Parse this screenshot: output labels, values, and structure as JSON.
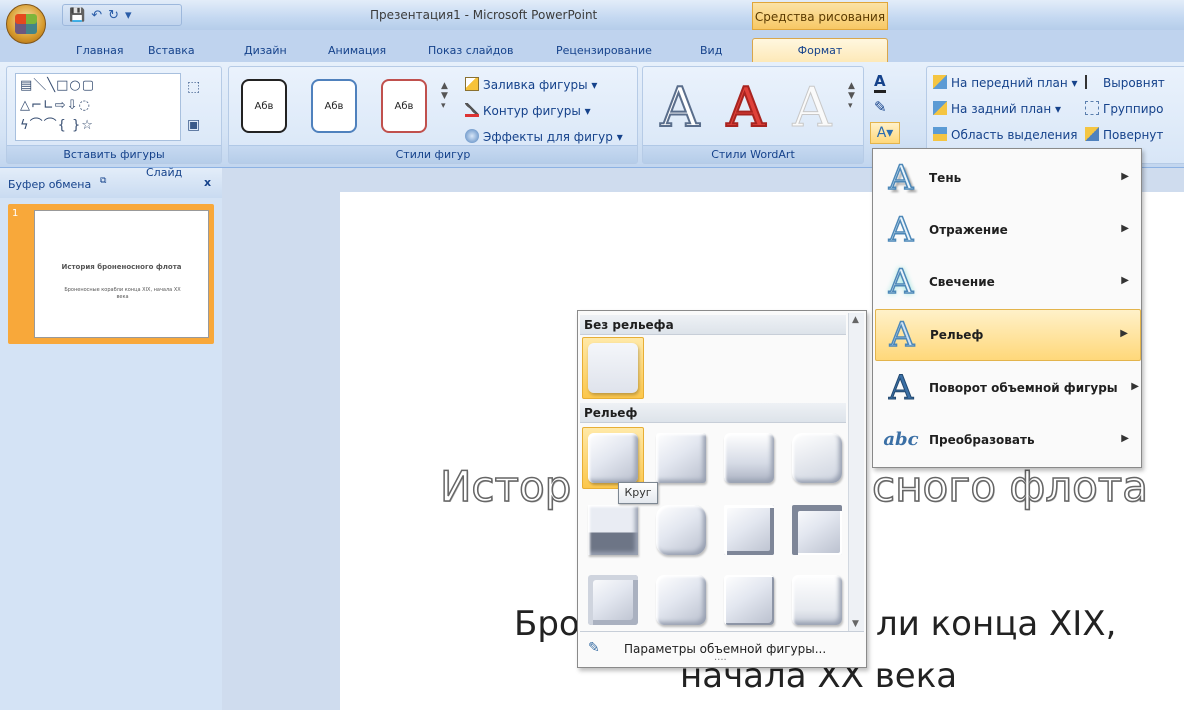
{
  "window": {
    "title": "Презентация1 - Microsoft PowerPoint",
    "contextual_title": "Средства рисования"
  },
  "quick_access": {
    "save_icon": "save-icon",
    "undo_icon": "undo-icon",
    "redo_icon": "redo-icon"
  },
  "tabs": [
    {
      "label": "Главная"
    },
    {
      "label": "Вставка"
    },
    {
      "label": "Дизайн"
    },
    {
      "label": "Анимация"
    },
    {
      "label": "Показ слайдов"
    },
    {
      "label": "Рецензирование"
    },
    {
      "label": "Вид"
    },
    {
      "label": "Формат",
      "active": true
    }
  ],
  "ribbon": {
    "insert_shapes": {
      "label": "Вставить фигуры"
    },
    "shape_styles": {
      "label": "Стили фигур",
      "style_sample": "Абв",
      "fill": "Заливка фигуры",
      "outline": "Контур фигуры",
      "effects": "Эффекты для фигур"
    },
    "wordart_styles": {
      "label": "Стили WordArt",
      "sample": "A"
    },
    "arrange": {
      "bring_front": "На передний план",
      "send_back": "На задний план",
      "selection_pane": "Область выделения",
      "align": "Выровнят",
      "group": "Группиро",
      "rotate": "Повернут"
    }
  },
  "left_pane": {
    "clipboard_label": "Буфер обмена",
    "slide_tab": "Слайд",
    "close": "x",
    "slide_number": "1",
    "thumb_title": "История броненосного флота",
    "thumb_sub": "Броненосные корабли конца XIX, начала XX века"
  },
  "slide": {
    "title_left": "Истор",
    "title_right": "сного флота",
    "sub_left": "Бро",
    "sub_right": "ли конца XIX,",
    "sub_line2": "начала XX века"
  },
  "text_effects_menu": {
    "items": [
      {
        "label": "Тень",
        "icon": "text-shadow-icon"
      },
      {
        "label": "Отражение",
        "icon": "text-reflection-icon"
      },
      {
        "label": "Свечение",
        "icon": "text-glow-icon"
      },
      {
        "label": "Рельеф",
        "icon": "text-bevel-icon",
        "highlighted": true
      },
      {
        "label": "Поворот объемной фигуры",
        "icon": "3d-rotation-icon"
      },
      {
        "label": "Преобразовать",
        "icon": "text-transform-icon"
      }
    ]
  },
  "bevel_gallery": {
    "no_bevel_header": "Без рельефа",
    "bevel_header": "Рельеф",
    "tooltip": "Круг",
    "options_label": "Параметры объемной фигуры...",
    "grip": "...."
  }
}
